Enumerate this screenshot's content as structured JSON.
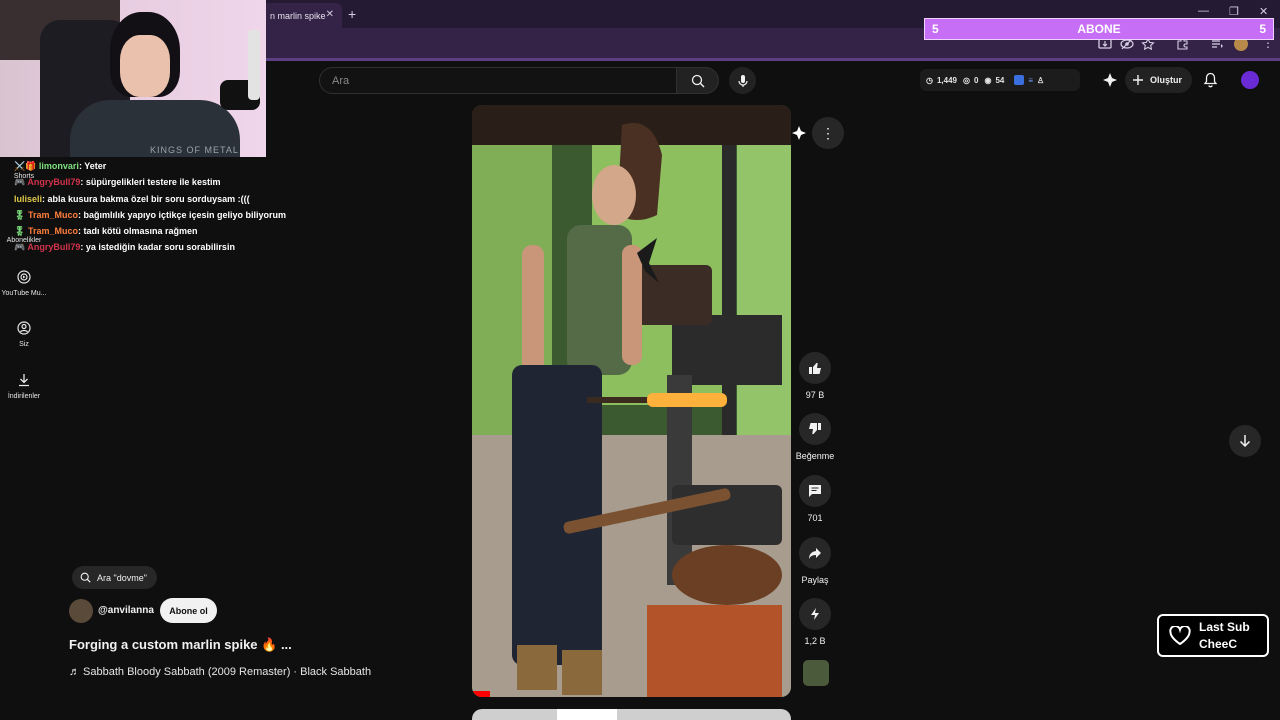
{
  "browser": {
    "tab_title": "n marlin spike",
    "new_tab": "+"
  },
  "overlay": {
    "webcam_shirt_text": "KINGS OF METAL",
    "abone": {
      "left_count": "5",
      "label": "ABONE",
      "right_count": "5"
    },
    "chat": [
      {
        "badges": "⚔️🎁 ",
        "user": "limonvari",
        "user_color": "#7ee07e",
        "message": "Yeter"
      },
      {
        "badges": "🎮 ",
        "user": "AngryBull79",
        "user_color": "#d2334b",
        "message": "süpürgelikleri testere ile kestim"
      },
      {
        "badges": "",
        "user": "luliseli",
        "user_color": "#e0c94a",
        "message": "abla kusura bakma özel bir soru sorduysam :((("
      },
      {
        "badges": "🎖 ",
        "user": "Tram_Muco",
        "user_color": "#ff7f3c",
        "message": "bağımlılık yapıyo içtikçe içesin geliyo biliyorum"
      },
      {
        "badges": "🎖 ",
        "user": "Tram_Muco",
        "user_color": "#ff7f3c",
        "message": "tadı kötü olmasına rağmen"
      },
      {
        "badges": "🎮 ",
        "user": "AngryBull79",
        "user_color": "#d2334b",
        "message": "ya istediğin kadar soru sorabilirsin"
      }
    ],
    "last_sub": {
      "label": "Last Sub",
      "name": "CheeC"
    }
  },
  "nav": {
    "items": [
      {
        "label": "Shorts"
      },
      {
        "label": "Abonelikler"
      },
      {
        "label": "YouTube Mu..."
      },
      {
        "label": "Siz"
      },
      {
        "label": "İndirilenler"
      }
    ]
  },
  "masthead": {
    "search_placeholder": "Ara",
    "stats": {
      "views": "1,449",
      "zero": "0",
      "count": "54"
    },
    "create_label": "Oluştur"
  },
  "short": {
    "search_chip": "Ara \"dovme\"",
    "channel": "@anvilanna",
    "subscribe": "Abone ol",
    "title": "Forging a custom marlin spike 🔥 ...",
    "music": "♬ Sabbath Bloody Sabbath (2009 Remaster) · Black Sabbath",
    "actions": {
      "like_count": "97 B",
      "dislike_label": "Beğenme",
      "comments_count": "701",
      "share_label": "Paylaş",
      "remix_count": "1,2 B"
    }
  },
  "colors": {
    "accent_purple": "#c66ef5",
    "youtube_bg": "#0f0f0f",
    "browser_chrome": "#342347"
  }
}
